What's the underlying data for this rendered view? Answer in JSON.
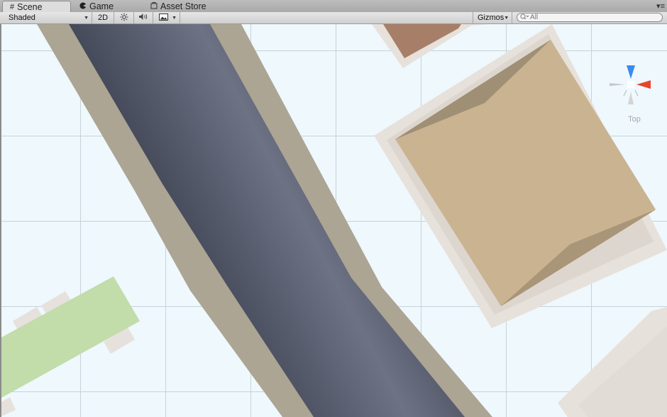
{
  "tabs": [
    {
      "label": "Scene",
      "icon": "grid-icon",
      "active": true
    },
    {
      "label": "Game",
      "icon": "pacman-icon",
      "active": false
    },
    {
      "label": "Asset Store",
      "icon": "bag-icon",
      "active": false
    }
  ],
  "tab_menu_glyph": "▾≡",
  "toolbar": {
    "shading_mode": "Shaded",
    "mode_2d": "2D",
    "gizmos_label": "Gizmos",
    "search_placeholder": "All"
  },
  "scene_gizmo": {
    "view_label": "Top",
    "y_axis_color": "#3b8af0",
    "x_axis_color": "#e8442c"
  },
  "scene_colors": {
    "background": "#eef8fd",
    "grid_line": "#c7d3d8",
    "road_edge": "#aca594",
    "road_asphalt": "#5b6070",
    "building_roof": "#c9b391",
    "building_border": "#e7e1db",
    "building_brown": "#a77f68",
    "park_green": "#c2dcaa"
  }
}
